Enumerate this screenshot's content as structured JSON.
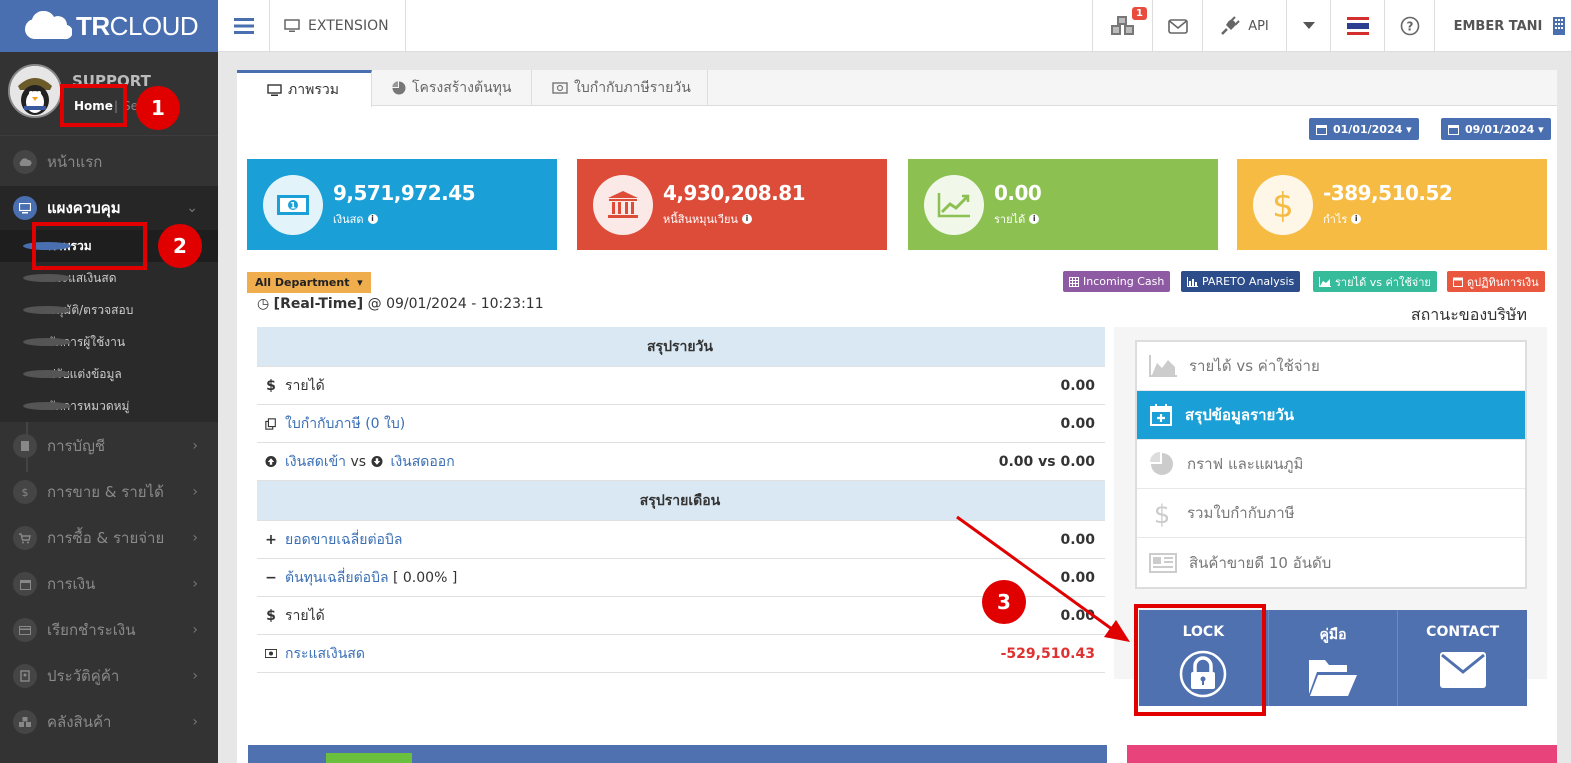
{
  "brand": {
    "bold": "TR",
    "light": "CLOUD"
  },
  "topbar": {
    "extension": "EXTENSION",
    "notif_count": "1",
    "api": "API",
    "user": "EMBER TANI"
  },
  "profile": {
    "name": "SUPPORT",
    "home": "Home",
    "sep": "|",
    "sep_tail": "Se"
  },
  "sidebar": {
    "items": [
      {
        "label": "หน้าแรก",
        "icon": "cloud-icon"
      },
      {
        "label": "แผงควบคุม",
        "icon": "monitor-icon"
      },
      {
        "label": "การบัญชี",
        "icon": "book-icon"
      },
      {
        "label": "การขาย & รายได้",
        "icon": "dollar-icon"
      },
      {
        "label": "การซื้อ & รายจ่าย",
        "icon": "cart-icon"
      },
      {
        "label": "การเงิน",
        "icon": "calendar-icon"
      },
      {
        "label": "เรียกชำระเงิน",
        "icon": "card-icon"
      },
      {
        "label": "ประวัติคู่ค้า",
        "icon": "contact-book-icon"
      },
      {
        "label": "คลังสินค้า",
        "icon": "cubes-icon"
      }
    ],
    "subitems": [
      "ภาพรวม",
      "กระแสเงินสด",
      "อนุมัติ/ตรวจสอบ",
      "จัดการผู้ใช้งาน",
      "ปรับแต่งข้อมูล",
      "จัดการหมวดหมู่"
    ]
  },
  "tabs": [
    "ภาพรวม",
    "โครงสร้างต้นทุน",
    "ใบกำกับภาษีรายวัน"
  ],
  "dates": {
    "start": "01/01/2024",
    "end": "09/01/2024"
  },
  "cards": [
    {
      "value": "9,571,972.45",
      "label": "เงินสด",
      "color": "#1a9fd6",
      "icon": "banknote-icon"
    },
    {
      "value": "4,930,208.81",
      "label": "หนี้สินหมุนเวียน",
      "color": "#dd4b39",
      "icon": "bank-icon"
    },
    {
      "value": "0.00",
      "label": "รายได้",
      "color": "#8cc152",
      "icon": "chart-line-icon"
    },
    {
      "value": "-389,510.52",
      "label": "กำไร",
      "color": "#f6bb42",
      "icon": "dollar-icon"
    }
  ],
  "department": "All Department",
  "quick_buttons": [
    {
      "label": "Incoming Cash",
      "color": "#8e5aa3"
    },
    {
      "label": "PARETO Analysis",
      "color": "#2c4d8a"
    },
    {
      "label": "รายได้ vs ค่าใช้จ่าย",
      "color": "#37bc9b"
    },
    {
      "label": "ดูปฏิทินการเงิน",
      "color": "#e9573f"
    }
  ],
  "realtime": {
    "label": "[Real-Time]",
    "at": "@",
    "datetime": "09/01/2024 - 10:23:11"
  },
  "status_title": "สถานะของบริษัท",
  "daily": {
    "header": "สรุปรายวัน",
    "rows": [
      {
        "label": "รายได้",
        "value": "0.00"
      },
      {
        "label": "ใบกำกับภาษี (0 ใบ)",
        "value": "0.00"
      },
      {
        "label_in": "เงินสดเข้า",
        "vs": "vs",
        "label_out": "เงินสดออก",
        "value": "0.00 vs 0.00"
      }
    ]
  },
  "monthly": {
    "header": "สรุปรายเดือน",
    "rows": [
      {
        "label": "ยอดขายเฉลี่ยต่อบิล",
        "value": "0.00"
      },
      {
        "label": "ต้นทุนเฉลี่ยต่อบิล",
        "suffix": "[ 0.00% ]",
        "value": "0.00"
      },
      {
        "label": "รายได้",
        "value": "0.00"
      },
      {
        "label": "กระแสเงินสด",
        "value": "-529,510.43"
      }
    ]
  },
  "status_list": [
    {
      "label": "รายได้ vs ค่าใช้จ่าย"
    },
    {
      "label": "สรุปข้อมูลรายวัน"
    },
    {
      "label": "กราฟ และแผนภูมิ"
    },
    {
      "label": "รวมใบกำกับภาษี"
    },
    {
      "label": "สินค้าขายดี 10 อันดับ"
    }
  ],
  "actions": [
    {
      "label": "LOCK"
    },
    {
      "label": "คู่มือ"
    },
    {
      "label": "CONTACT"
    }
  ],
  "annotations": [
    "1",
    "2",
    "3"
  ]
}
